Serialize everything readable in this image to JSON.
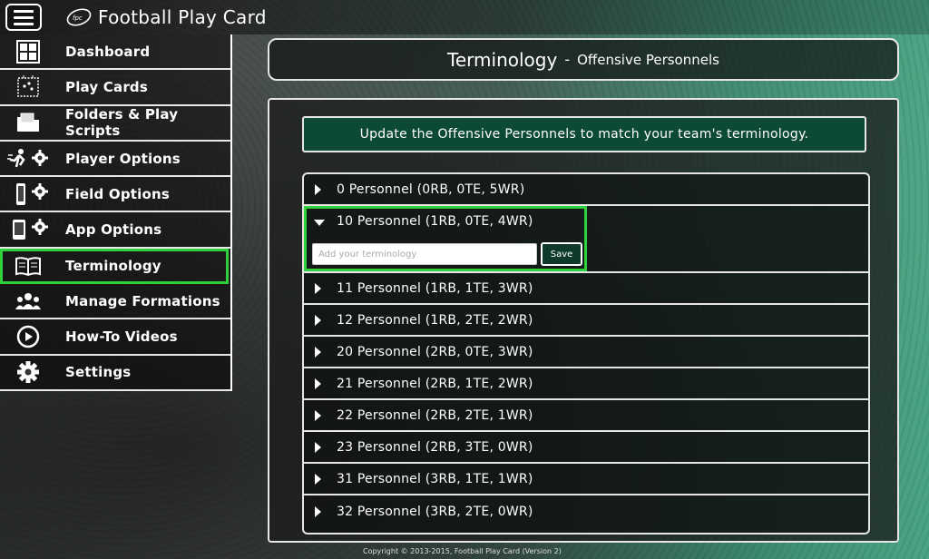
{
  "app": {
    "title": "Football Play Card",
    "logo_text": "fpc"
  },
  "sidebar": {
    "items": [
      {
        "label": "Dashboard",
        "icon": "dashboard-grid-icon"
      },
      {
        "label": "Play Cards",
        "icon": "play-cards-icon"
      },
      {
        "label": "Folders & Play Scripts",
        "icon": "folder-icon"
      },
      {
        "label": "Player Options",
        "icon": "player-gear-icon"
      },
      {
        "label": "Field Options",
        "icon": "field-gear-icon"
      },
      {
        "label": "App Options",
        "icon": "app-gear-icon"
      },
      {
        "label": "Terminology",
        "icon": "book-icon",
        "active": true
      },
      {
        "label": "Manage Formations",
        "icon": "group-icon"
      },
      {
        "label": "How-To Videos",
        "icon": "play-circle-icon"
      },
      {
        "label": "Settings",
        "icon": "gear-icon"
      }
    ]
  },
  "header": {
    "title": "Terminology",
    "separator": "-",
    "subtitle": "Offensive Personnels"
  },
  "banner": {
    "text": "Update the Offensive Personnels to match your team's terminology."
  },
  "personnel": {
    "rows": [
      {
        "label": "0 Personnel (0RB, 0TE, 5WR)"
      },
      {
        "label": "10 Personnel (1RB, 0TE, 4WR)",
        "expanded": true
      },
      {
        "label": "11 Personnel (1RB, 1TE, 3WR)"
      },
      {
        "label": "12 Personnel (1RB, 2TE, 2WR)"
      },
      {
        "label": "20 Personnel (2RB, 0TE, 3WR)"
      },
      {
        "label": "21 Personnel (2RB, 1TE, 2WR)"
      },
      {
        "label": "22 Personnel (2RB, 2TE, 1WR)"
      },
      {
        "label": "23 Personnel (2RB, 3TE, 0WR)"
      },
      {
        "label": "31 Personnel (3RB, 1TE, 1WR)"
      },
      {
        "label": "32 Personnel (3RB, 2TE, 0WR)"
      }
    ],
    "input_placeholder": "Add your terminology",
    "input_value": "",
    "save_label": "Save"
  },
  "footer": {
    "copyright": "Copyright © 2013-2015, Football Play Card (Version 2)"
  },
  "colors": {
    "active_outline": "#2fd03a",
    "banner_bg": "#0d4a34",
    "save_bg": "#0d3a2a"
  }
}
